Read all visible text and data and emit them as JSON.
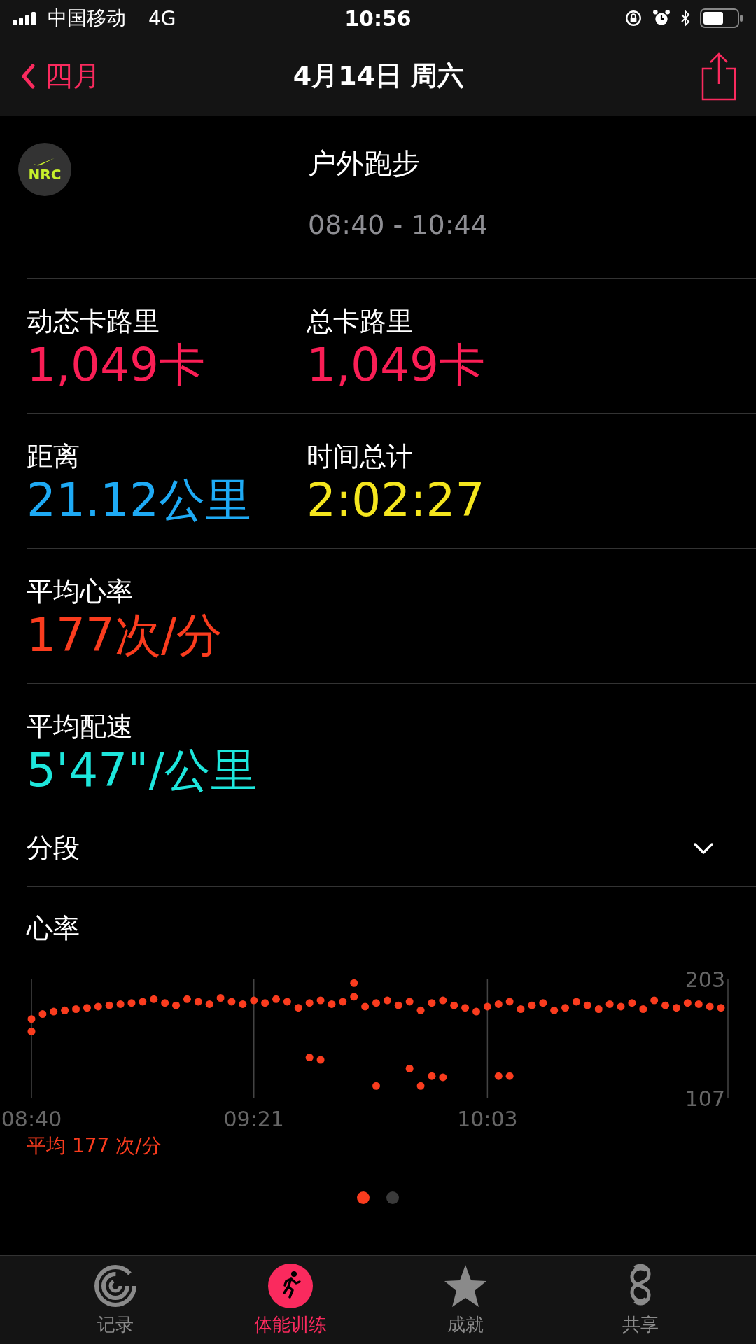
{
  "status_bar": {
    "carrier": "中国移动",
    "network": "4G",
    "time": "10:56"
  },
  "nav": {
    "back": "四月",
    "title": "4月14日 周六"
  },
  "workout": {
    "app_logo": "NRC",
    "name": "户外跑步",
    "time_range": "08:40 - 10:44"
  },
  "metric_rows": [
    {
      "metrics": [
        {
          "label": "动态卡路里",
          "value": "1,049卡",
          "color": "#fa1e55"
        },
        {
          "label": "总卡路里",
          "value": "1,049卡",
          "color": "#fa1e55"
        }
      ]
    },
    {
      "metrics": [
        {
          "label": "距离",
          "value": "21.12公里",
          "color": "#1eaaf5"
        },
        {
          "label": "时间总计",
          "value": "2:02:27",
          "color": "#f5e61e"
        }
      ]
    },
    {
      "metrics": [
        {
          "label": "平均心率",
          "value": "177次/分",
          "color": "#fa3c1e"
        }
      ]
    },
    {
      "metrics": [
        {
          "label": "平均配速",
          "value": "5'47\"/公里",
          "color": "#1ee6dc"
        }
      ]
    }
  ],
  "splits": {
    "label": "分段",
    "expanded": false
  },
  "heart_rate": {
    "title": "心率",
    "average": "平均 177 次/分",
    "chart_data": {
      "type": "scatter",
      "grid": true,
      "ylim": [
        107,
        203
      ],
      "yticks": [
        107,
        203
      ],
      "categories": [
        "08:40",
        null,
        null,
        null,
        null,
        null,
        null,
        null,
        null,
        null,
        null,
        null,
        null,
        null,
        null,
        null,
        null,
        null,
        null,
        null,
        "09:21",
        null,
        null,
        null,
        null,
        null,
        null,
        null,
        null,
        null,
        null,
        null,
        null,
        null,
        null,
        null,
        null,
        null,
        null,
        null,
        null,
        "10:03",
        null,
        null,
        null,
        null,
        null,
        null,
        null,
        null,
        null,
        null,
        null,
        null,
        null,
        null,
        null,
        null,
        null,
        null,
        null,
        null,
        null
      ],
      "series": [
        {
          "color": "#fa3c1e",
          "values": [
            171,
            175,
            177,
            178,
            179,
            180,
            181,
            182,
            183,
            184,
            185,
            187,
            184,
            182,
            187,
            185,
            183,
            188,
            185,
            183,
            186,
            184,
            187,
            185,
            180,
            184,
            186,
            183,
            185,
            189,
            181,
            184,
            186,
            182,
            185,
            178,
            184,
            186,
            182,
            180,
            177,
            181,
            183,
            185,
            179,
            182,
            184,
            178,
            180,
            185,
            182,
            179,
            183,
            181,
            184,
            179,
            186,
            182,
            180,
            184,
            183,
            181,
            180
          ]
        },
        {
          "color": "#fa3c1e",
          "values": [
            161,
            null,
            null,
            null,
            null,
            null,
            null,
            null,
            null,
            null,
            null,
            null,
            null,
            null,
            null,
            null,
            null,
            null,
            null,
            null,
            null,
            null,
            null,
            null,
            null,
            140,
            138,
            null,
            null,
            200,
            null,
            117,
            null,
            null,
            131,
            117,
            125,
            124,
            null,
            null,
            null,
            null,
            125,
            125,
            null,
            null,
            null,
            null,
            null,
            null,
            null,
            null,
            null,
            null,
            null,
            null,
            null,
            null,
            null,
            null,
            null,
            null,
            null
          ]
        }
      ]
    }
  },
  "pages": [
    {
      "selected": true
    },
    {
      "selected": false
    }
  ],
  "tabs": [
    {
      "label": "记录",
      "kind": "rings",
      "selected": false
    },
    {
      "label": "体能训练",
      "kind": "runner",
      "selected": true
    },
    {
      "label": "成就",
      "kind": "star",
      "selected": false
    },
    {
      "label": "共享",
      "kind": "loops",
      "selected": false
    }
  ]
}
